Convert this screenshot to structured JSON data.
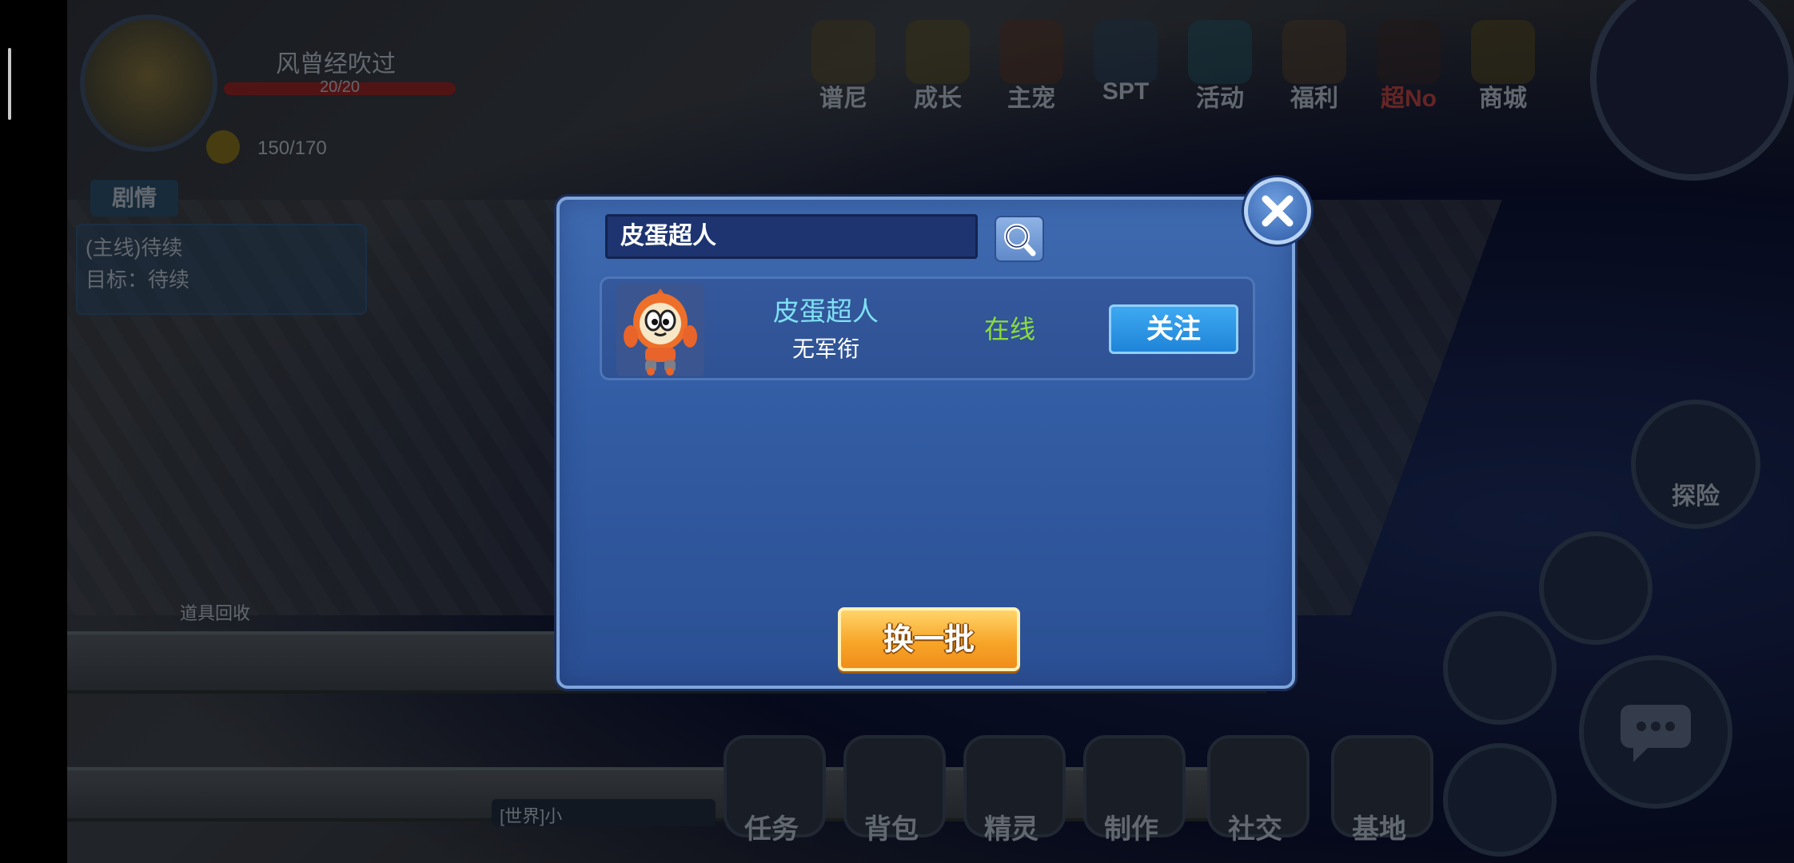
{
  "hud": {
    "player_name": "风曾经吹过",
    "hp": "20/20",
    "energy": "150/170",
    "story_tab": "剧情",
    "quest_title": "(主线)待续",
    "quest_goal": "目标：待续",
    "recycle_label": "道具回收",
    "explore_label": "探险",
    "world_hint": "[世界]小"
  },
  "top_menu": [
    "谱尼",
    "成长",
    "主宠",
    "SPT",
    "活动",
    "福利",
    "超No",
    "商城"
  ],
  "bottom_menu": [
    "任务",
    "背包",
    "精灵",
    "制作",
    "社交",
    "基地"
  ],
  "dialog": {
    "search_value": "皮蛋超人",
    "result": {
      "name": "皮蛋超人",
      "rank": "无军衔",
      "status": "在线",
      "follow_label": "关注"
    },
    "refresh_label": "换一批"
  },
  "colors": {
    "dialog_bg": "#325ca3",
    "name_cyan": "#7fe0f4",
    "online_green": "#8bdc3d",
    "follow_blue": "#1f84d8",
    "refresh_orange": "#f7a629"
  },
  "icons": {
    "search": "search-icon",
    "close": "close-icon",
    "chat": "chat-icon"
  }
}
